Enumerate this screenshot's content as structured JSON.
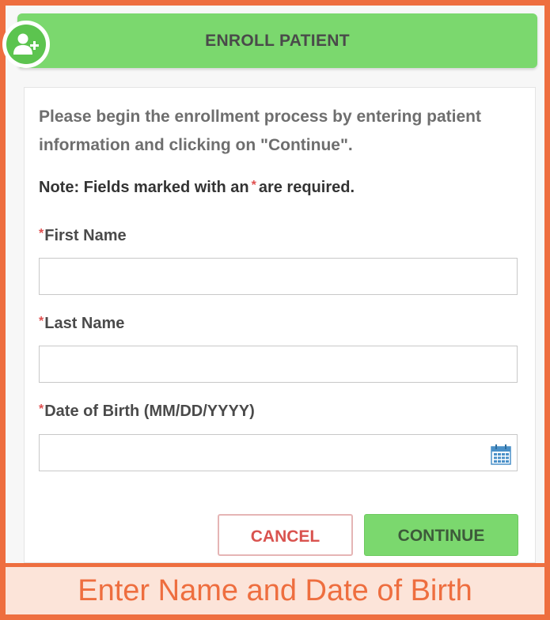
{
  "header": {
    "title": "ENROLL PATIENT",
    "icon": "add-user-icon",
    "color": "#7bd86e"
  },
  "form": {
    "intro": "Please begin the enrollment process by entering patient information and clicking on \"Continue\".",
    "note_prefix": "Note: Fields marked with an",
    "note_asterisk": "*",
    "note_suffix": "are required.",
    "required_marker": "*",
    "fields": [
      {
        "label": "First Name",
        "value": ""
      },
      {
        "label": "Last Name",
        "value": ""
      },
      {
        "label": "Date of Birth (MM/DD/YYYY)",
        "value": "",
        "icon": "calendar-icon"
      }
    ]
  },
  "buttons": {
    "cancel": "CANCEL",
    "continue": "CONTINUE"
  },
  "caption": "Enter Name and Date of Birth",
  "colors": {
    "frame": "#ee6e3f",
    "accent_green": "#7bd86e",
    "required": "#e05050"
  }
}
